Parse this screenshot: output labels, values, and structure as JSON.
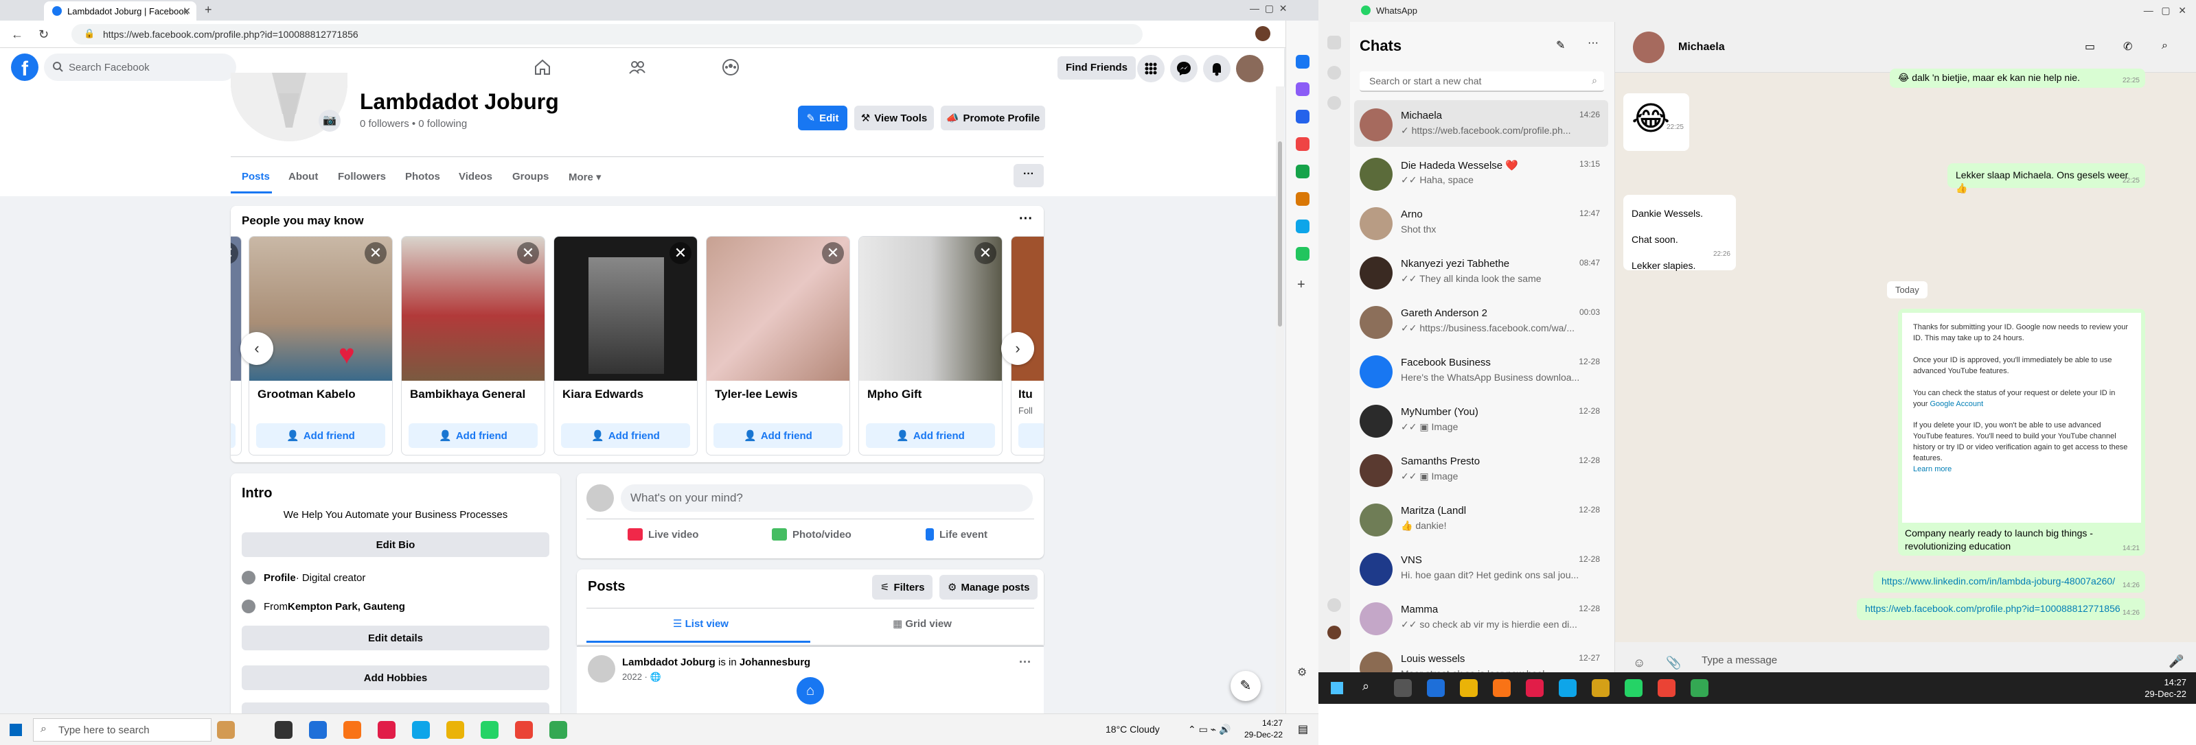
{
  "browser": {
    "tab_title": "Lambdadot Joburg | Facebook",
    "url": "https://web.facebook.com/profile.php?id=100088812771856"
  },
  "facebook": {
    "search_placeholder": "Search Facebook",
    "find_friends": "Find Friends",
    "profile_name": "Lambdadot Joburg",
    "followers_line": "0 followers • 0 following",
    "edit_btn": "Edit",
    "view_tools_btn": "View Tools",
    "promote_btn": "Promote Profile",
    "tabs": [
      "Posts",
      "About",
      "Followers",
      "Photos",
      "Videos",
      "Groups",
      "More"
    ],
    "pymk": {
      "title": "People you may know",
      "add_label": "Add friend",
      "cards": [
        {
          "name": "Grootman Kabelo"
        },
        {
          "name": "Bambikhaya General"
        },
        {
          "name": "Kiara Edwards"
        },
        {
          "name": "Tyler-lee Lewis"
        },
        {
          "name": "Mpho Gift"
        },
        {
          "name": "Itu"
        }
      ],
      "partial_sub": "Foll"
    },
    "intro": {
      "title": "Intro",
      "bio": "We Help You Automate your Business Processes",
      "edit_bio": "Edit Bio",
      "profile_label": "Profile",
      "profile_value": " · Digital creator",
      "from_label": "From ",
      "from_value": "Kempton Park, Gauteng",
      "edit_details": "Edit details",
      "add_hobbies": "Add Hobbies"
    },
    "composer": {
      "placeholder": "What's on your mind?",
      "live": "Live video",
      "photo": "Photo/video",
      "event": "Life event"
    },
    "posts": {
      "title": "Posts",
      "filters": "Filters",
      "manage": "Manage posts",
      "list_view": "List view",
      "grid_view": "Grid view",
      "post_author": "Lambdadot Joburg",
      "post_is_in": " is in ",
      "post_place": "Johannesburg",
      "post_meta": "2022 · ",
      "post_more": "···"
    }
  },
  "taskbar_left": {
    "search": "Type here to search",
    "weather": "18°C  Cloudy",
    "time": "14:27",
    "date": "29-Dec-22"
  },
  "whatsapp": {
    "window_title": "WhatsApp",
    "chats_heading": "Chats",
    "search_placeholder": "Search or start a new chat",
    "chats": [
      {
        "name": "Michaela",
        "time": "14:26",
        "msg": "✓ https://web.facebook.com/profile.ph..."
      },
      {
        "name": "Die Hadeda Wesselse ❤️",
        "time": "13:15",
        "msg": "✓✓ Haha, space"
      },
      {
        "name": "Arno",
        "time": "12:47",
        "msg": "Shot thx"
      },
      {
        "name": "Nkanyezi yezi Tabhethe",
        "time": "08:47",
        "msg": "✓✓ They all kinda look the same"
      },
      {
        "name": "Gareth Anderson 2",
        "time": "00:03",
        "msg": "✓✓ https://business.facebook.com/wa/..."
      },
      {
        "name": "Facebook Business",
        "time": "12-28",
        "msg": "Here's the WhatsApp Business downloa..."
      },
      {
        "name": "MyNumber (You)",
        "time": "12-28",
        "msg": "✓✓ ▣ Image"
      },
      {
        "name": "Samanths Presto",
        "time": "12-28",
        "msg": "✓✓ ▣ Image"
      },
      {
        "name": "Maritza (Landl",
        "time": "12-28",
        "msg": "👍 dankie!"
      },
      {
        "name": "VNS",
        "time": "12-28",
        "msg": "Hi. hoe gaan dit? Het gedink ons sal jou..."
      },
      {
        "name": "Mamma",
        "time": "12-28",
        "msg": "✓✓ so check ab vir my is hierdie een di..."
      },
      {
        "name": "Louis wessels",
        "time": "12-27",
        "msg": "Maar straat ek se is laer now heel..."
      }
    ],
    "contact": "Michaela",
    "messages": {
      "top_out": "😂 dalk 'n bietjie, maar ek kan nie help nie.",
      "top_out_time": "22:25",
      "emoji": "😂",
      "emoji_time": "22:25",
      "out2": "Lekker slaap Michaela. Ons gesels weer 👍",
      "out2_time": "22:25",
      "in_lines": [
        "Dankie Wessels.",
        "Chat soon.",
        "Lekker slapies."
      ],
      "in_time": "22:26",
      "today": "Today",
      "card_p1": "Thanks for submitting your ID. Google now needs to review your ID. This may take up to 24 hours.",
      "card_p2": "Once your ID is approved, you'll immediately be able to use advanced YouTube features.",
      "card_p3a": "You can check the status of your request or delete your ID in your ",
      "card_p3b": "Google Account",
      "card_p4": "If you delete your ID, you won't be able to use advanced YouTube features. You'll need to build your YouTube channel history or try ID or video verification again to get access to these features.",
      "card_learn": "Learn more",
      "card_caption": "Company nearly ready to launch big things - revolutionizing education",
      "card_time": "14:21",
      "link1": "https://www.linkedin.com/in/lambda-joburg-48007a260/",
      "link1_time": "14:26",
      "link2": "https://web.facebook.com/profile.php?id=100088812771856",
      "link2_time": "14:26"
    },
    "type_placeholder": "Type a message"
  },
  "taskbar_right": {
    "time": "14:27",
    "date": "29-Dec-22"
  }
}
